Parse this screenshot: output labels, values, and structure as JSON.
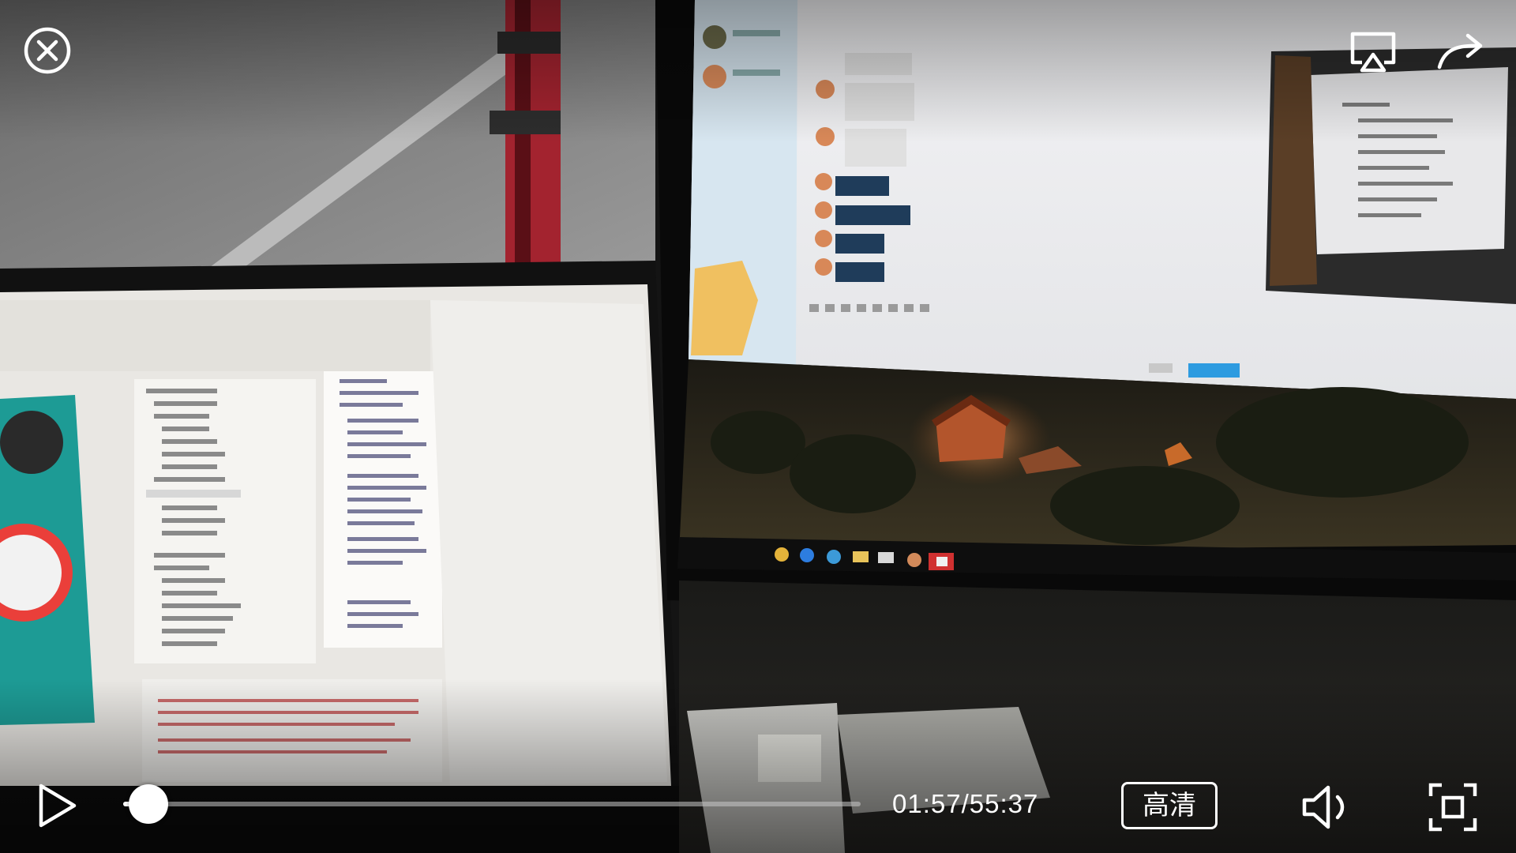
{
  "player": {
    "top_bar": {
      "close_icon": "close-circle-icon",
      "cast_icon": "airplay-icon",
      "share_icon": "share-forward-icon"
    },
    "controls": {
      "play_icon": "play-icon",
      "progress_fraction": 0.034,
      "current_time": "01:57",
      "separator": "/",
      "total_time": "55:37",
      "quality_label": "高清",
      "volume_icon": "speaker-icon",
      "fullscreen_icon": "fullscreen-icon"
    },
    "colors": {
      "controls": "#ffffff",
      "track": "#c8c8c8"
    }
  }
}
